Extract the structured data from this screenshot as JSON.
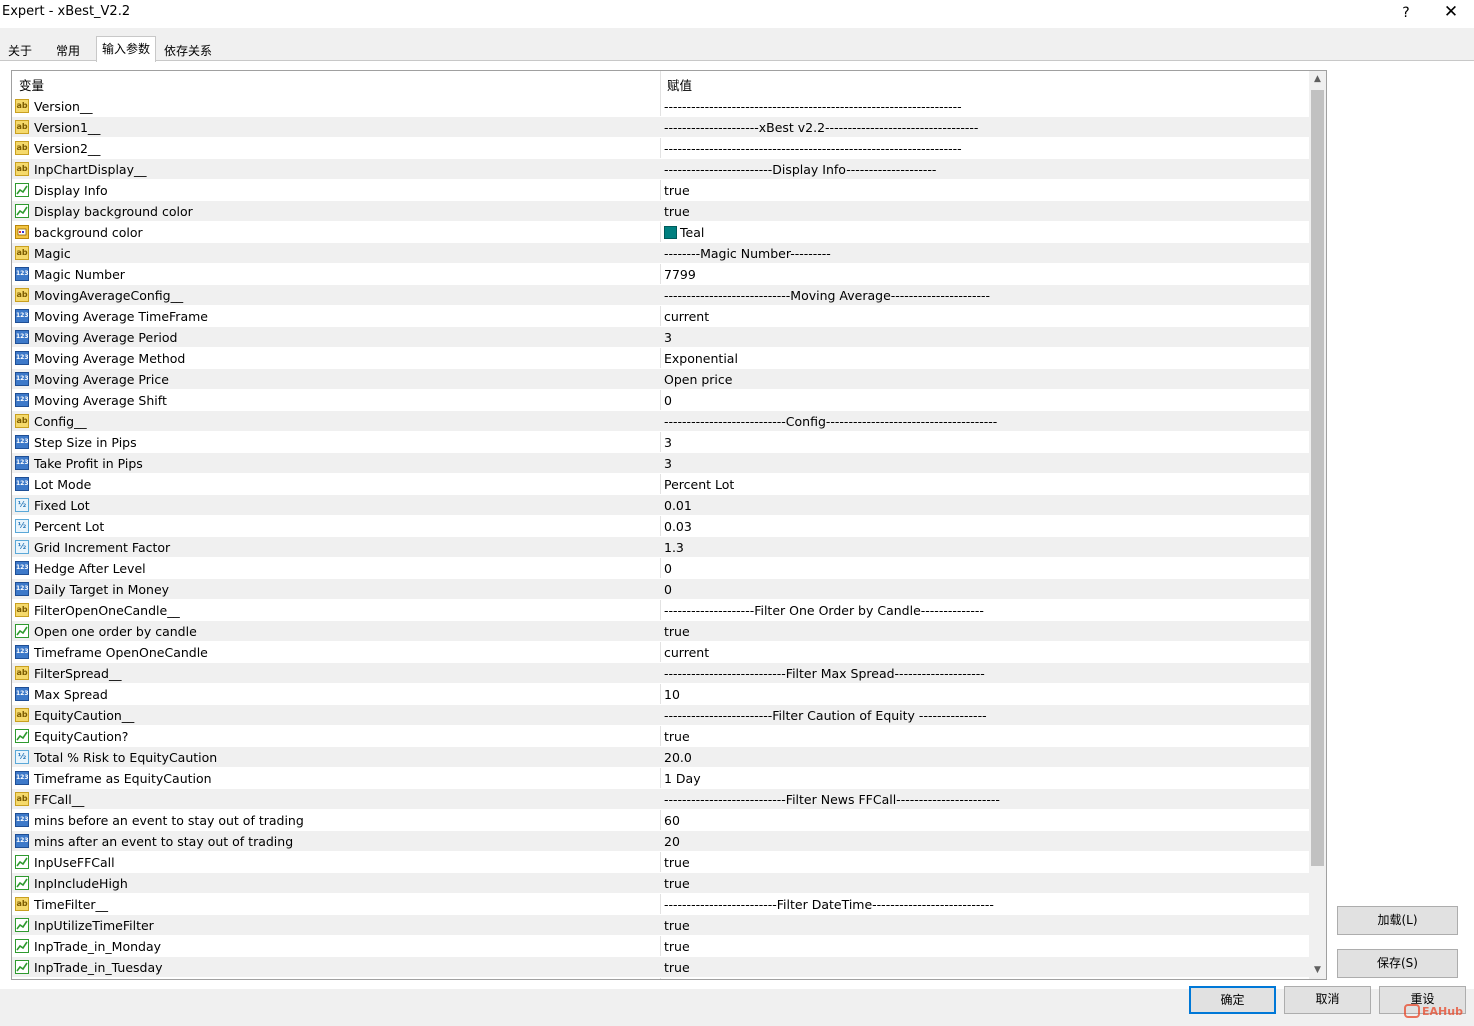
{
  "window": {
    "title": "Expert - xBest_V2.2",
    "help_label": "?",
    "close_label": "✕"
  },
  "tabs": [
    "关于",
    "常用",
    "输入参数",
    "依存关系"
  ],
  "list": {
    "headers": {
      "variable": "变量",
      "value": "赋值"
    },
    "rows": [
      {
        "type": "string",
        "name": "Version__",
        "value": "------------------------------------------------------------------"
      },
      {
        "type": "string",
        "name": "Version1__",
        "value": "---------------------xBest  v2.2----------------------------------"
      },
      {
        "type": "string",
        "name": "Version2__",
        "value": "------------------------------------------------------------------"
      },
      {
        "type": "string",
        "name": "InpChartDisplay__",
        "value": "------------------------Display Info--------------------"
      },
      {
        "type": "bool",
        "name": "Display Info",
        "value": "true"
      },
      {
        "type": "bool",
        "name": "Display background color",
        "value": "true"
      },
      {
        "type": "color",
        "name": "background color",
        "value": "Teal",
        "swatch": "#008080"
      },
      {
        "type": "string",
        "name": "Magic",
        "value": "--------Magic Number---------"
      },
      {
        "type": "int",
        "name": "Magic Number",
        "value": "7799"
      },
      {
        "type": "string",
        "name": "MovingAverageConfig__",
        "value": "----------------------------Moving Average----------------------"
      },
      {
        "type": "int",
        "name": "Moving Average TimeFrame",
        "value": "current"
      },
      {
        "type": "int",
        "name": "Moving Average Period",
        "value": "3"
      },
      {
        "type": "int",
        "name": "Moving Average Method",
        "value": "Exponential"
      },
      {
        "type": "int",
        "name": "Moving Average Price",
        "value": "Open price"
      },
      {
        "type": "int",
        "name": "Moving Average Shift",
        "value": "0"
      },
      {
        "type": "string",
        "name": "Config__",
        "value": "---------------------------Config--------------------------------------"
      },
      {
        "type": "int",
        "name": "Step Size in Pips",
        "value": "3"
      },
      {
        "type": "int",
        "name": "Take Profit in Pips",
        "value": "3"
      },
      {
        "type": "int",
        "name": "Lot Mode",
        "value": "Percent Lot"
      },
      {
        "type": "double",
        "name": "Fixed Lot",
        "value": "0.01"
      },
      {
        "type": "double",
        "name": "Percent Lot",
        "value": "0.03"
      },
      {
        "type": "double",
        "name": "Grid Increment Factor",
        "value": "1.3"
      },
      {
        "type": "int",
        "name": "Hedge After Level",
        "value": "0"
      },
      {
        "type": "int",
        "name": "Daily Target in Money",
        "value": "0"
      },
      {
        "type": "string",
        "name": "FilterOpenOneCandle__",
        "value": "--------------------Filter One Order by Candle--------------"
      },
      {
        "type": "bool",
        "name": "Open one order by candle",
        "value": "true"
      },
      {
        "type": "int",
        "name": "Timeframe OpenOneCandle",
        "value": "current"
      },
      {
        "type": "string",
        "name": "FilterSpread__",
        "value": "---------------------------Filter Max Spread--------------------"
      },
      {
        "type": "int",
        "name": "Max Spread",
        "value": "10"
      },
      {
        "type": "string",
        "name": "EquityCaution__",
        "value": "------------------------Filter Caution of Equity ---------------"
      },
      {
        "type": "bool",
        "name": "EquityCaution?",
        "value": "true"
      },
      {
        "type": "double",
        "name": "Total % Risk to EquityCaution",
        "value": "20.0"
      },
      {
        "type": "int",
        "name": "Timeframe as EquityCaution",
        "value": "1 Day"
      },
      {
        "type": "string",
        "name": "FFCall__",
        "value": "---------------------------Filter News FFCall-----------------------"
      },
      {
        "type": "int",
        "name": "mins before an event to stay out of trading",
        "value": "60"
      },
      {
        "type": "int",
        "name": "mins after  an event to stay out of trading",
        "value": "20"
      },
      {
        "type": "bool",
        "name": "InpUseFFCall",
        "value": "true"
      },
      {
        "type": "bool",
        "name": "InpIncludeHigh",
        "value": "true"
      },
      {
        "type": "string",
        "name": "TimeFilter__",
        "value": "-------------------------Filter DateTime---------------------------"
      },
      {
        "type": "bool",
        "name": "InpUtilizeTimeFilter",
        "value": "true"
      },
      {
        "type": "bool",
        "name": "InpTrade_in_Monday",
        "value": "true"
      },
      {
        "type": "bool",
        "name": "InpTrade_in_Tuesday",
        "value": "true"
      }
    ]
  },
  "icon_names": {
    "string": "ab-string-icon",
    "bool": "bool-chart-icon",
    "int": "int-123-icon",
    "double": "double-half-icon",
    "color": "color-palette-icon"
  },
  "buttons": {
    "load": "加载(L)",
    "save": "保存(S)",
    "ok": "确定",
    "cancel": "取消",
    "reset": "重设"
  },
  "watermark": "EAHub"
}
